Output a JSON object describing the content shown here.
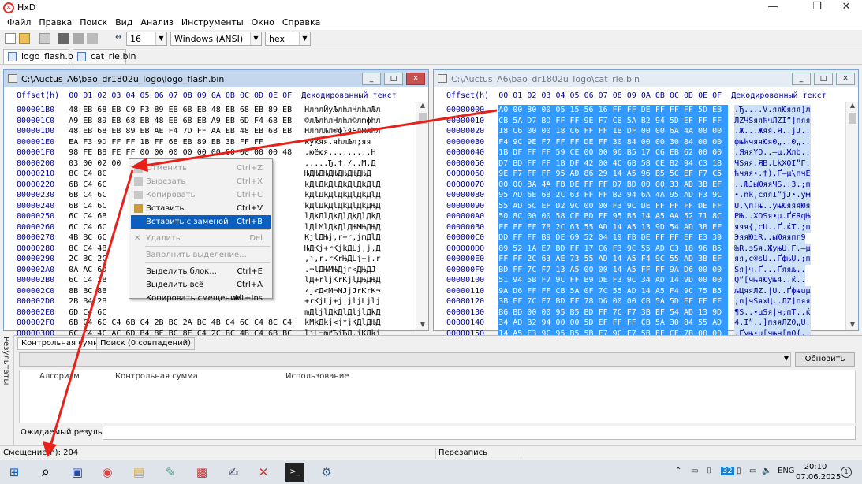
{
  "app": {
    "title": "HxD"
  },
  "menu": [
    "Файл",
    "Правка",
    "Поиск",
    "Вид",
    "Анализ",
    "Инструменты",
    "Окно",
    "Справка"
  ],
  "toolbar": {
    "bytes_per_row": "16",
    "charset": "Windows (ANSI)",
    "offset_base": "hex"
  },
  "file_tabs": [
    "logo_flash.bin",
    "cat_rle.bin"
  ],
  "left_window": {
    "title": "C:\\Auctus_A6\\bao_dr1802u_logo\\logo_flash.bin",
    "header": "Offset(h)  00 01 02 03 04 05 06 07 08 09 0A 0B 0C 0D 0E 0F",
    "text_header": "Декодированный текст",
    "rows": [
      {
        "off": "000001B0",
        "hex": "48 EB 68 EB C9 F3 89 EB 68 EB 48 EB 68 EB 89 EB",
        "txt": "HлhлЙуЉлhлHлhлЉл"
      },
      {
        "off": "000001C0",
        "hex": "A9 EB 89 EB 68 EB 48 EB 68 EB A9 EB 6D F4 68 EB",
        "txt": "©лЉлhлHлhл©лmфhл"
      },
      {
        "off": "000001D0",
        "hex": "48 EB 68 EB 89 EB AE F4 7D FF AA EB 48 EB 68 EB",
        "txt": "HлhлЉл®ф}яЄлHлhл"
      },
      {
        "off": "000001E0",
        "hex": "EA F3 9D FF FF 1B FF 68 EB 89 EB 3B FF FF",
        "txt": "куќяя.яhлЉл;яя"
      },
      {
        "off": "000001F0",
        "hex": "98 FE B8 FE FF 00 00 00 00 00 00 00 00 00 00 48",
        "txt": ".юёюя.........H"
      },
      {
        "off": "00000200",
        "hex": "03 00 02 00",
        "txt": ".....Ђ.†./..М.Д"
      },
      {
        "off": "00000210",
        "hex": "8C C4 8C",
        "txt": "ЊДЊДЊДЊДЊДЊДЊД"
      },
      {
        "off": "00000220",
        "hex": "6B C4 6C",
        "txt": "kДlДkДlДkДlДkДlД"
      },
      {
        "off": "00000230",
        "hex": "6B C4 6C",
        "txt": "kДlДkДlДkДlДkДlД"
      },
      {
        "off": "00000240",
        "hex": "6B C4 6C",
        "txt": "kДlДkДlДkДlДkДЊД"
      },
      {
        "off": "00000250",
        "hex": "6C C4 6B",
        "txt": "lДkДlДkДlДkДlДkД"
      },
      {
        "off": "00000260",
        "hex": "6C C4 6C",
        "txt": "lДlМlДkДlДЊМЊДЊД"
      },
      {
        "off": "00000270",
        "hex": "4B BC 6C",
        "txt": "KjlДЊj,r+r,jmДlД"
      },
      {
        "off": "00000280",
        "hex": "8C C4 4B",
        "txt": "ЊДKj+rKjkДLj,j,Д"
      },
      {
        "off": "00000290",
        "hex": "2C BC 2C",
        "txt": ",j,r.rKrЊДLj+j.r"
      },
      {
        "off": "000002A0",
        "hex": "0A AC 6D",
        "txt": ".¬lДЊМЊДjг<ДЊДЈ"
      },
      {
        "off": "000002B0",
        "hex": "6C C4 2B",
        "txt": "lД+rljKrKjlДЊДЊД"
      },
      {
        "off": "000002C0",
        "hex": "8B BC 8B",
        "txt": "‹j<Д<М¬МJjJrKrK¬"
      },
      {
        "off": "000002D0",
        "hex": "2B B4 2B",
        "txt": "+rKjLj+j.jljLjlj"
      },
      {
        "off": "000002E0",
        "hex": "6D C4 6C",
        "txt": "mДljlДkДlДljlДkД"
      },
      {
        "off": "000002F0",
        "hex": "6B C4 6C C4 6B C4 2B BC 2A BC 4B C4 6C C4 8C C4",
        "txt": "kМkДkj<j*jKДlДЊД"
      },
      {
        "off": "00000300",
        "hex": "6C C4 4C AC 6D B4 8E BC 8E C4 2C BC 4B C4 6B BC",
        "txt": "lјL¬mґЋјЋД,јKДkј"
      }
    ]
  },
  "right_window": {
    "title": "C:\\Auctus_A6\\bao_dr1802u_logo\\cat_rle.bin",
    "header": "Offset(h)  00 01 02 03 04 05 06 07 08 09 0A 0B 0C 0D 0E 0F",
    "text_header": "Декодированный текст",
    "rows": [
      {
        "off": "00000000",
        "hex": "A0 00 80 00 05 15 56 16 FF FF DE FF FF FF 5D EB",
        "txt": ".Ђ....V.яяЮяяя]л"
      },
      {
        "off": "00000010",
        "hex": "CB 5A D7 BD FF FF 9E F7 CB 5A B2 94 5D EF FF FF",
        "txt": "ЛZЧЅяяћчЛZІ”]пяя"
      },
      {
        "off": "00000020",
        "hex": "18 C6 00 00 18 C6 FF FF 1B DF 00 00 6A 4A 00 00",
        "txt": ".Ж...Жяя.Я..jJ.."
      },
      {
        "off": "00000030",
        "hex": "F4 9C 9E F7 FF FF DE FF 30 84 00 00 30 84 00 00",
        "txt": "фњћчяяЮя0„..0„.."
      },
      {
        "off": "00000040",
        "hex": "1B DF FF FF 59 CE 00 00 96 B5 17 C6 EB 62 00 00",
        "txt": ".ЯяяYО..–µ.Жлb.."
      },
      {
        "off": "00000050",
        "hex": "D7 BD FF FF 1B DF 42 00 4C 6B 58 CE B2 94 C3 18",
        "txt": "ЧЅяя.ЯB.LkXОІ”Г."
      },
      {
        "off": "00000060",
        "hex": "9E F7 FF FF 95 AD 86 29 14 A5 96 B5 5C EF F7 C5",
        "txt": "ћчяя•.†).Ґ–µ\\пчЕ"
      },
      {
        "off": "00000070",
        "hex": "00 00 8A 4A FB DE FF FF D7 BD 00 00 33 AD 3B EF",
        "txt": "..ЉJыЮяяЧЅ..3.;п"
      },
      {
        "off": "00000080",
        "hex": "95 AD 6E 6B 2C 63 FF FF B2 94 6A 4A 95 AD F3 9C",
        "txt": "•.nk,cяяІ”jJ•.ум"
      },
      {
        "off": "00000090",
        "hex": "55 AD 5C EF D2 9C 00 00 F3 9C DE FF FF FF DE FF",
        "txt": "U.\\пТњ..уњЮяяяЮя"
      },
      {
        "off": "000000A0",
        "hex": "50 8C 00 00 58 CE BD FF 95 B5 14 A5 AA 52 71 8C",
        "txt": "PЊ..XОЅя•µ.ҐЄRqЊ"
      },
      {
        "off": "000000B0",
        "hex": "FF FF FF 7B 2C 63 55 AD 14 A5 13 9D 54 AD 3B EF",
        "txt": "яяя{,cU..Ґ.ќT.;п"
      },
      {
        "off": "000000C0",
        "hex": "DD FF FF B9 DE 69 52 04 19 FB DE FF FF EF E3 39",
        "txt": "ЭяяЮiR..ыЮяяпг9"
      },
      {
        "off": "000000D0",
        "hex": "89 52 1A E7 BD FF 17 C6 F3 9C 55 AD C3 18 96 B5",
        "txt": "‰R.зЅя.ЖуњU.Г.–µ"
      },
      {
        "off": "000000E0",
        "hex": "FF FF 2C 63 AE 73 55 AD 14 A5 F4 9C 55 AD 3B EF",
        "txt": "яя,c®sU..ҐфњU.;п"
      },
      {
        "off": "000000F0",
        "hex": "BD FF 7C F7 13 A5 00 00 14 A5 FF FF 9A D6 00 00",
        "txt": "Ѕя|ч.Ґ...Ґяяљ.."
      },
      {
        "off": "00000100",
        "hex": "51 94 5B F7 9C FF B9 DE F3 9C 34 AD 14 9D 00 00",
        "txt": "Q”[чњяЮуњ4..ќ.."
      },
      {
        "off": "00000110",
        "hex": "9A D6 FF FF CB 5A 0F 7C 55 AD 14 A5 F4 9C 75 B5",
        "txt": "љЦяяЛZ.|U..Ґфњuµ"
      },
      {
        "off": "00000120",
        "hex": "3B EF 7C F7 BD FF 78 D6 00 00 CB 5A 5D EF FF FF",
        "txt": ";п|чЅяxЦ..ЛZ]пяя"
      },
      {
        "off": "00000130",
        "hex": "B6 BD 00 00 95 B5 BD FF 7C F7 3B EF 54 AD 13 9D",
        "txt": "¶Ѕ..•µЅя|ч;пT..ќ"
      },
      {
        "off": "00000140",
        "hex": "34 AD B2 94 00 00 5D EF FF FF CB 5A 30 84 55 AD",
        "txt": "4.І”..]пяяЛZ0„U."
      },
      {
        "off": "00000150",
        "hex": "14 A5 F3 9C 95 B5 5B F7 9C F7 5B EF CE 7B 00 00",
        "txt": ".Ґуњ•µ[чњч[пО{.."
      }
    ]
  },
  "context_menu": {
    "items": [
      {
        "label": "Отменить",
        "key": "Ctrl+Z",
        "enabled": false,
        "highlighted": false,
        "icon": "undo-icon"
      },
      {
        "label": "Вырезать",
        "key": "Ctrl+X",
        "enabled": false,
        "highlighted": false,
        "icon": "cut-icon"
      },
      {
        "label": "Копировать",
        "key": "Ctrl+C",
        "enabled": false,
        "highlighted": false,
        "icon": "copy-icon"
      },
      {
        "label": "Вставить",
        "key": "Ctrl+V",
        "enabled": true,
        "highlighted": false,
        "icon": "paste-icon"
      },
      {
        "label": "Вставить с заменой",
        "key": "Ctrl+B",
        "enabled": true,
        "highlighted": true,
        "icon": ""
      },
      {
        "label": "Удалить",
        "key": "Del",
        "enabled": false,
        "highlighted": false,
        "icon": "delete-icon"
      },
      {
        "label": "Заполнить выделение...",
        "key": "",
        "enabled": false,
        "highlighted": false,
        "icon": ""
      },
      {
        "label": "Выделить блок...",
        "key": "Ctrl+E",
        "enabled": true,
        "highlighted": false,
        "icon": ""
      },
      {
        "label": "Выделить всё",
        "key": "Ctrl+A",
        "enabled": true,
        "highlighted": false,
        "icon": ""
      },
      {
        "label": "Копировать смещение",
        "key": "Alt+Ins",
        "enabled": true,
        "highlighted": false,
        "icon": ""
      }
    ]
  },
  "results": {
    "side_label": "Результаты",
    "tabs": [
      "Контрольная сумма",
      "Поиск (0 совпадений)"
    ],
    "update_button": "Обновить",
    "columns": [
      "Алгоритм",
      "Контрольная сумма",
      "Использование"
    ],
    "expected_label": "Ожидаемый результат:"
  },
  "status": {
    "offset": "Смещение(h): 204",
    "mode": "Перезапись"
  },
  "taskbar": {
    "lang": "ENG",
    "time": "20:10",
    "date": "07.06.2025",
    "notif": "1",
    "badge": "32"
  },
  "colors": {
    "selection": "#3399ff",
    "menu_highlight": "#0b5fc1",
    "arrow": "#e8201a",
    "offset_text": "#0000a0"
  }
}
